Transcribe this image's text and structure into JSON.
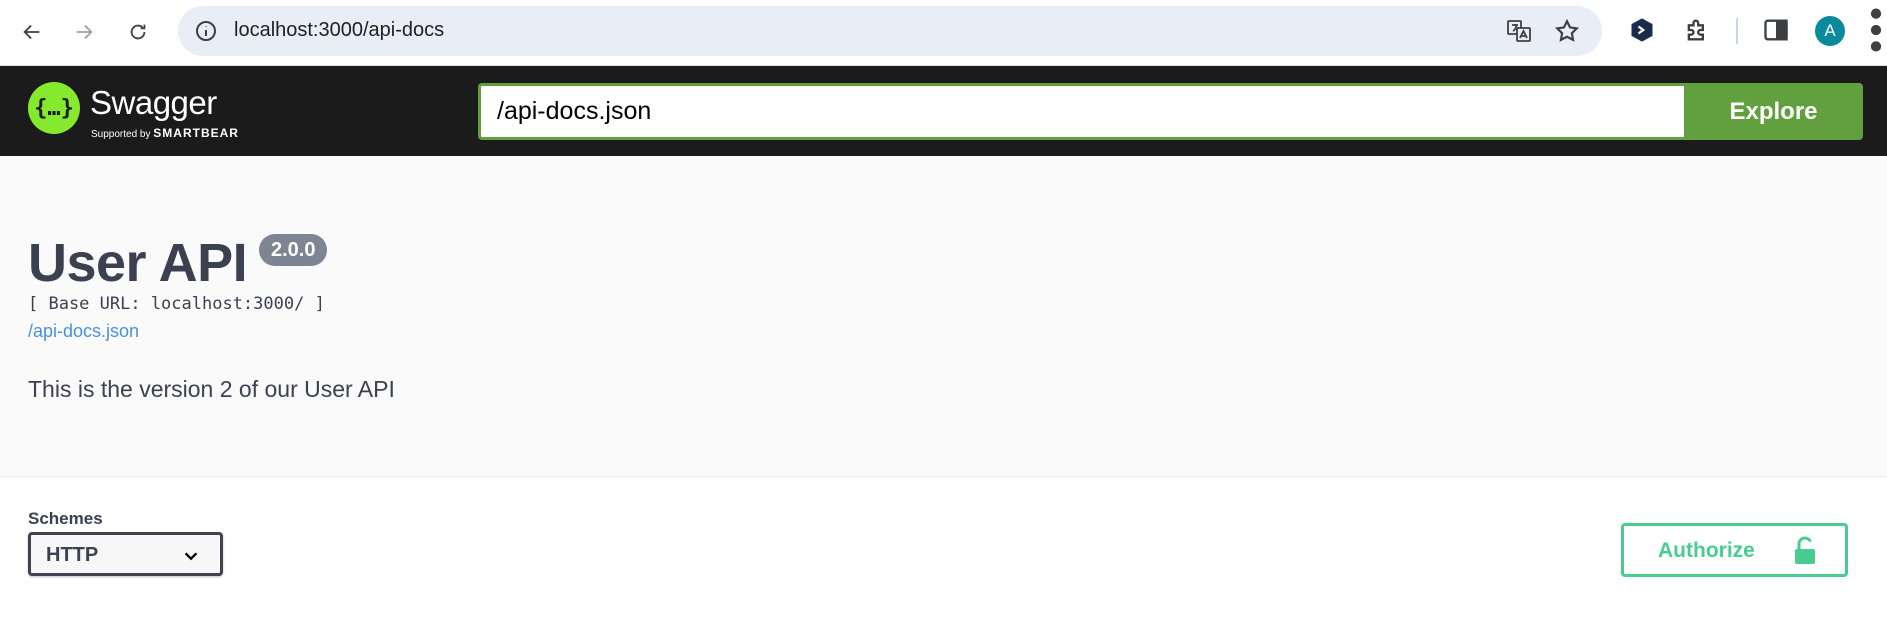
{
  "browser": {
    "url": "localhost:3000/api-docs",
    "profile_initial": "A",
    "icons": [
      "back-icon",
      "forward-icon",
      "reload-icon",
      "site-info-icon",
      "translate-icon",
      "bookmark-star-icon",
      "extension-devtools-icon",
      "extensions-puzzle-icon",
      "side-panel-icon",
      "more-menu-icon"
    ]
  },
  "topbar": {
    "logo_symbol": "{…}",
    "logo_name": "Swagger",
    "logo_tm": ".",
    "logo_supported": "Supported by",
    "logo_brand": "SMARTBEAR",
    "spec_url": "/api-docs.json",
    "explore_label": "Explore",
    "accent_color": "#62a03f"
  },
  "info": {
    "title": "User API",
    "version": "2.0.0",
    "base_url": "[ Base URL: localhost:3000/ ]",
    "spec_link": "/api-docs.json",
    "description": "This is the version 2 of our User API"
  },
  "schemes": {
    "label": "Schemes",
    "selected": "HTTP"
  },
  "authorize": {
    "label": "Authorize",
    "color": "#49cc90"
  }
}
